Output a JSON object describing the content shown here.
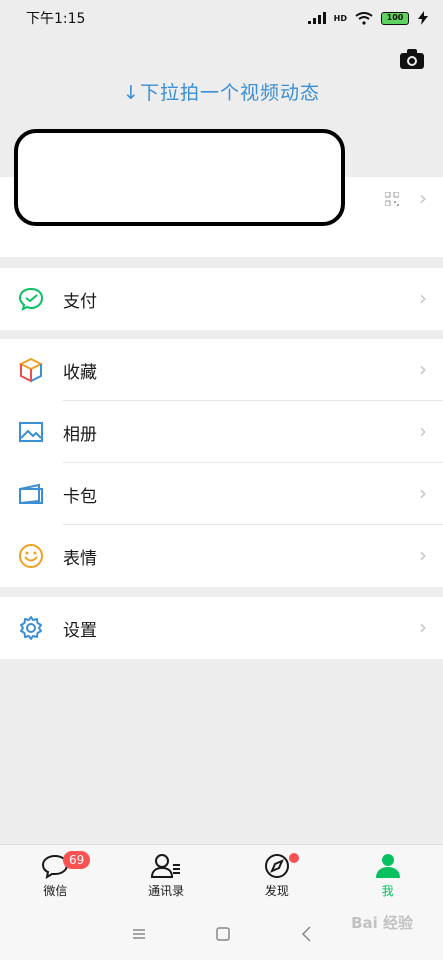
{
  "status": {
    "time": "下午1:15",
    "network": "HD",
    "battery": "100"
  },
  "pull_hint": "↓下拉拍一个视频动态",
  "menu": {
    "pay": "支付",
    "favorites": "收藏",
    "album": "相册",
    "cards": "卡包",
    "stickers": "表情",
    "settings": "设置"
  },
  "tabs": [
    {
      "label": "微信",
      "badge": "69"
    },
    {
      "label": "通讯录"
    },
    {
      "label": "发现"
    },
    {
      "label": "我"
    }
  ],
  "chevron": "›",
  "watermark": "Bai 经验"
}
